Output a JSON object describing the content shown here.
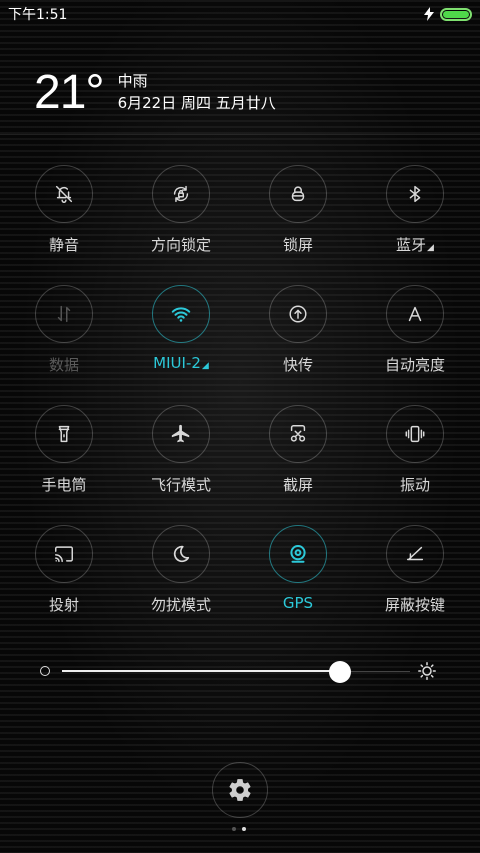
{
  "status": {
    "time": "下午1:51",
    "charging_icon": "lightning-icon",
    "battery_level": 1.0,
    "battery_color": "#4fd84a"
  },
  "weather": {
    "temperature": "21°",
    "condition": "中雨",
    "date": "6月22日 周四 五月廿八"
  },
  "toggles": [
    {
      "label": "静音",
      "icon": "bell-off-icon",
      "state": "off"
    },
    {
      "label": "方向锁定",
      "icon": "rotation-lock-icon",
      "state": "off"
    },
    {
      "label": "锁屏",
      "icon": "lock-icon",
      "state": "off"
    },
    {
      "label": "蓝牙",
      "icon": "bluetooth-icon",
      "state": "off",
      "has_menu": true
    },
    {
      "label": "数据",
      "icon": "data-arrows-icon",
      "state": "disabled"
    },
    {
      "label": "MIUI-2",
      "icon": "wifi-icon",
      "state": "on",
      "has_menu": true
    },
    {
      "label": "快传",
      "icon": "quick-transfer-icon",
      "state": "off"
    },
    {
      "label": "自动亮度",
      "icon": "auto-brightness-icon",
      "state": "off"
    },
    {
      "label": "手电筒",
      "icon": "flashlight-icon",
      "state": "off"
    },
    {
      "label": "飞行模式",
      "icon": "airplane-icon",
      "state": "off"
    },
    {
      "label": "截屏",
      "icon": "screenshot-icon",
      "state": "off"
    },
    {
      "label": "振动",
      "icon": "vibrate-icon",
      "state": "off"
    },
    {
      "label": "投射",
      "icon": "cast-icon",
      "state": "off"
    },
    {
      "label": "勿扰模式",
      "icon": "moon-icon",
      "state": "off"
    },
    {
      "label": "GPS",
      "icon": "gps-icon",
      "state": "on"
    },
    {
      "label": "屏蔽按键",
      "icon": "block-keys-icon",
      "state": "off"
    }
  ],
  "menu_indicator": "◢",
  "brightness": {
    "level": 0.8
  },
  "pager": {
    "count": 2,
    "current": 2
  },
  "colors": {
    "accent": "#2cc9d9",
    "background": "#070707"
  }
}
